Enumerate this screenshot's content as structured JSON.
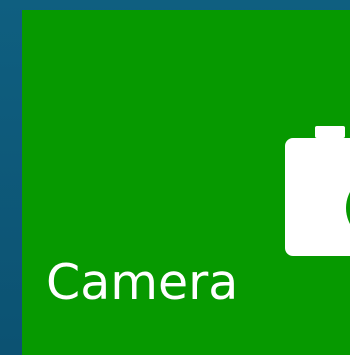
{
  "tile": {
    "label": "Camera",
    "icon": "camera-icon",
    "background_color": "#069900"
  },
  "desktop": {
    "background_color": "#0e5a7a"
  }
}
